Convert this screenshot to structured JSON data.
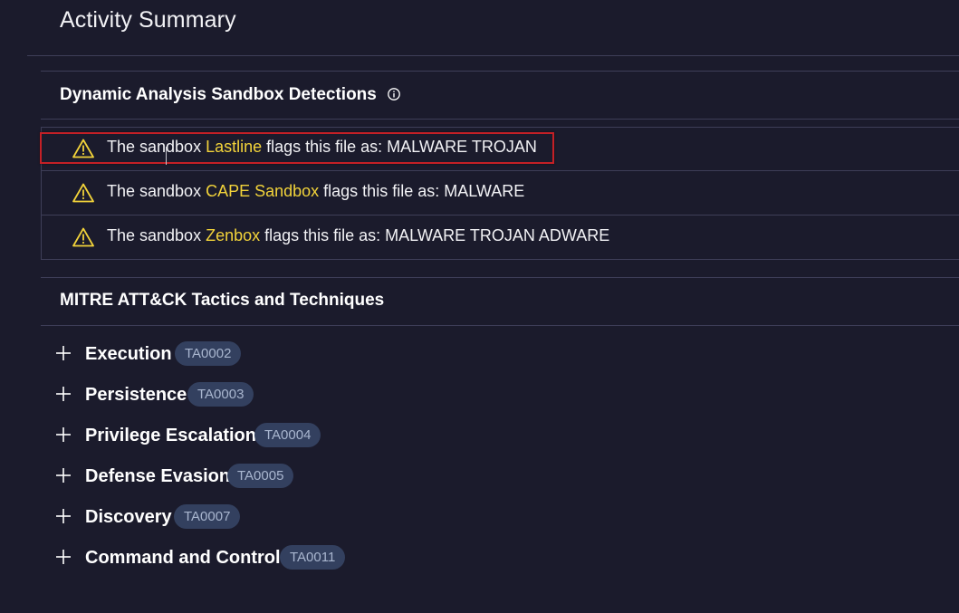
{
  "header": {
    "title": "Activity Summary"
  },
  "sandbox_section": {
    "title": "Dynamic Analysis Sandbox Detections",
    "info_icon": "info-circle-icon",
    "detections": [
      {
        "prefix": "The sandbox ",
        "sandbox": "Lastline",
        "suffix": " flags this file as: MALWARE TROJAN",
        "icon": "warning-triangle-icon"
      },
      {
        "prefix": "The sandbox ",
        "sandbox": "CAPE Sandbox",
        "suffix": " flags this file as: MALWARE",
        "icon": "warning-triangle-icon"
      },
      {
        "prefix": "The sandbox ",
        "sandbox": "Zenbox",
        "suffix": " flags this file as: MALWARE TROJAN ADWARE",
        "icon": "warning-triangle-icon"
      }
    ]
  },
  "mitre_section": {
    "title": "MITRE ATT&CK Tactics and Techniques",
    "tactics": [
      {
        "name": "Execution",
        "id": "TA0002"
      },
      {
        "name": "Persistence",
        "id": "TA0003"
      },
      {
        "name": "Privilege Escalation",
        "id": "TA0004"
      },
      {
        "name": "Defense Evasion",
        "id": "TA0005"
      },
      {
        "name": "Discovery",
        "id": "TA0007"
      },
      {
        "name": "Command and Control",
        "id": "TA0011"
      }
    ]
  },
  "colors": {
    "background": "#1b1b2c",
    "divider": "#3e3e58",
    "sandbox_highlight": "#f2d33a",
    "warning_icon": "#f2d33a",
    "badge_bg": "#33405f",
    "badge_text": "#a9b6cf",
    "annotation_box": "#c42026"
  }
}
